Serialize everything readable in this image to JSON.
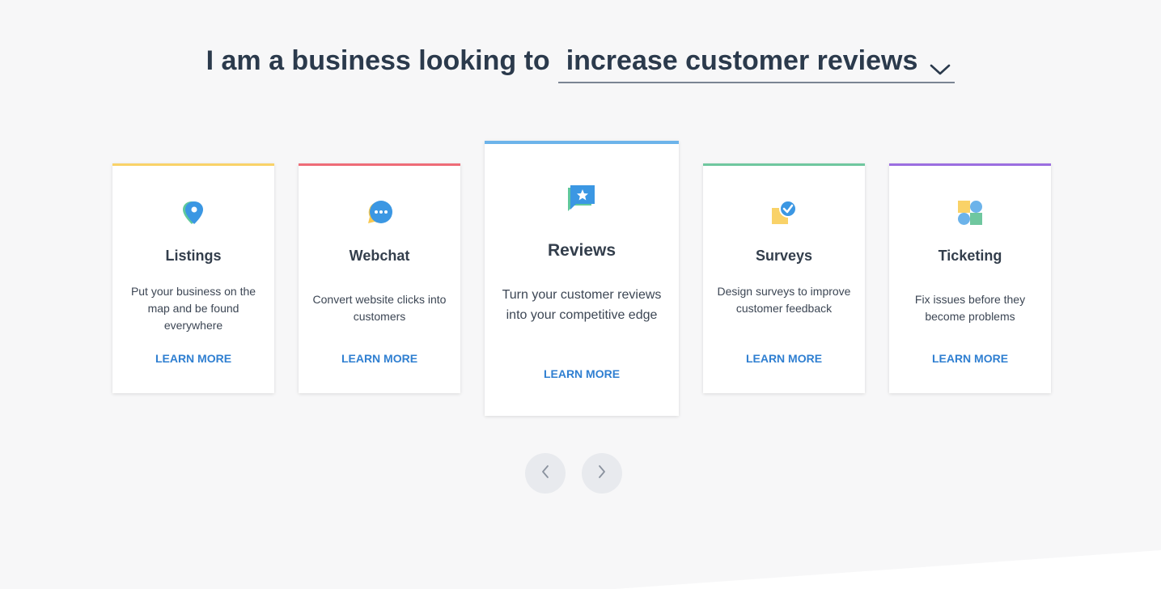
{
  "headline": {
    "prefix": "I am a business looking to",
    "selected_goal": "increase customer reviews"
  },
  "cards": [
    {
      "title": "Listings",
      "description": "Put your business on the map and be found everywhere",
      "link": "LEARN MORE",
      "accent": "#f9d268",
      "icon": "map-pin-icon"
    },
    {
      "title": "Webchat",
      "description": "Convert website clicks into customers",
      "link": "LEARN MORE",
      "accent": "#ee6c77",
      "icon": "chat-bubble-icon"
    },
    {
      "title": "Reviews",
      "description": "Turn your customer reviews into your competitive edge",
      "link": "LEARN MORE",
      "accent": "#6cb3ea",
      "icon": "star-message-icon"
    },
    {
      "title": "Surveys",
      "description": "Design surveys to improve customer feedback",
      "link": "LEARN MORE",
      "accent": "#6fc79f",
      "icon": "checkmark-badge-icon"
    },
    {
      "title": "Ticketing",
      "description": "Fix issues before they become problems",
      "link": "LEARN MORE",
      "accent": "#9b6ee0",
      "icon": "shapes-icon"
    }
  ],
  "carousel": {
    "prev_icon": "chevron-left-icon",
    "next_icon": "chevron-right-icon"
  },
  "colors": {
    "background": "#f7f7f8",
    "link": "#2f7fd1",
    "heading": "#2b3a4c"
  }
}
